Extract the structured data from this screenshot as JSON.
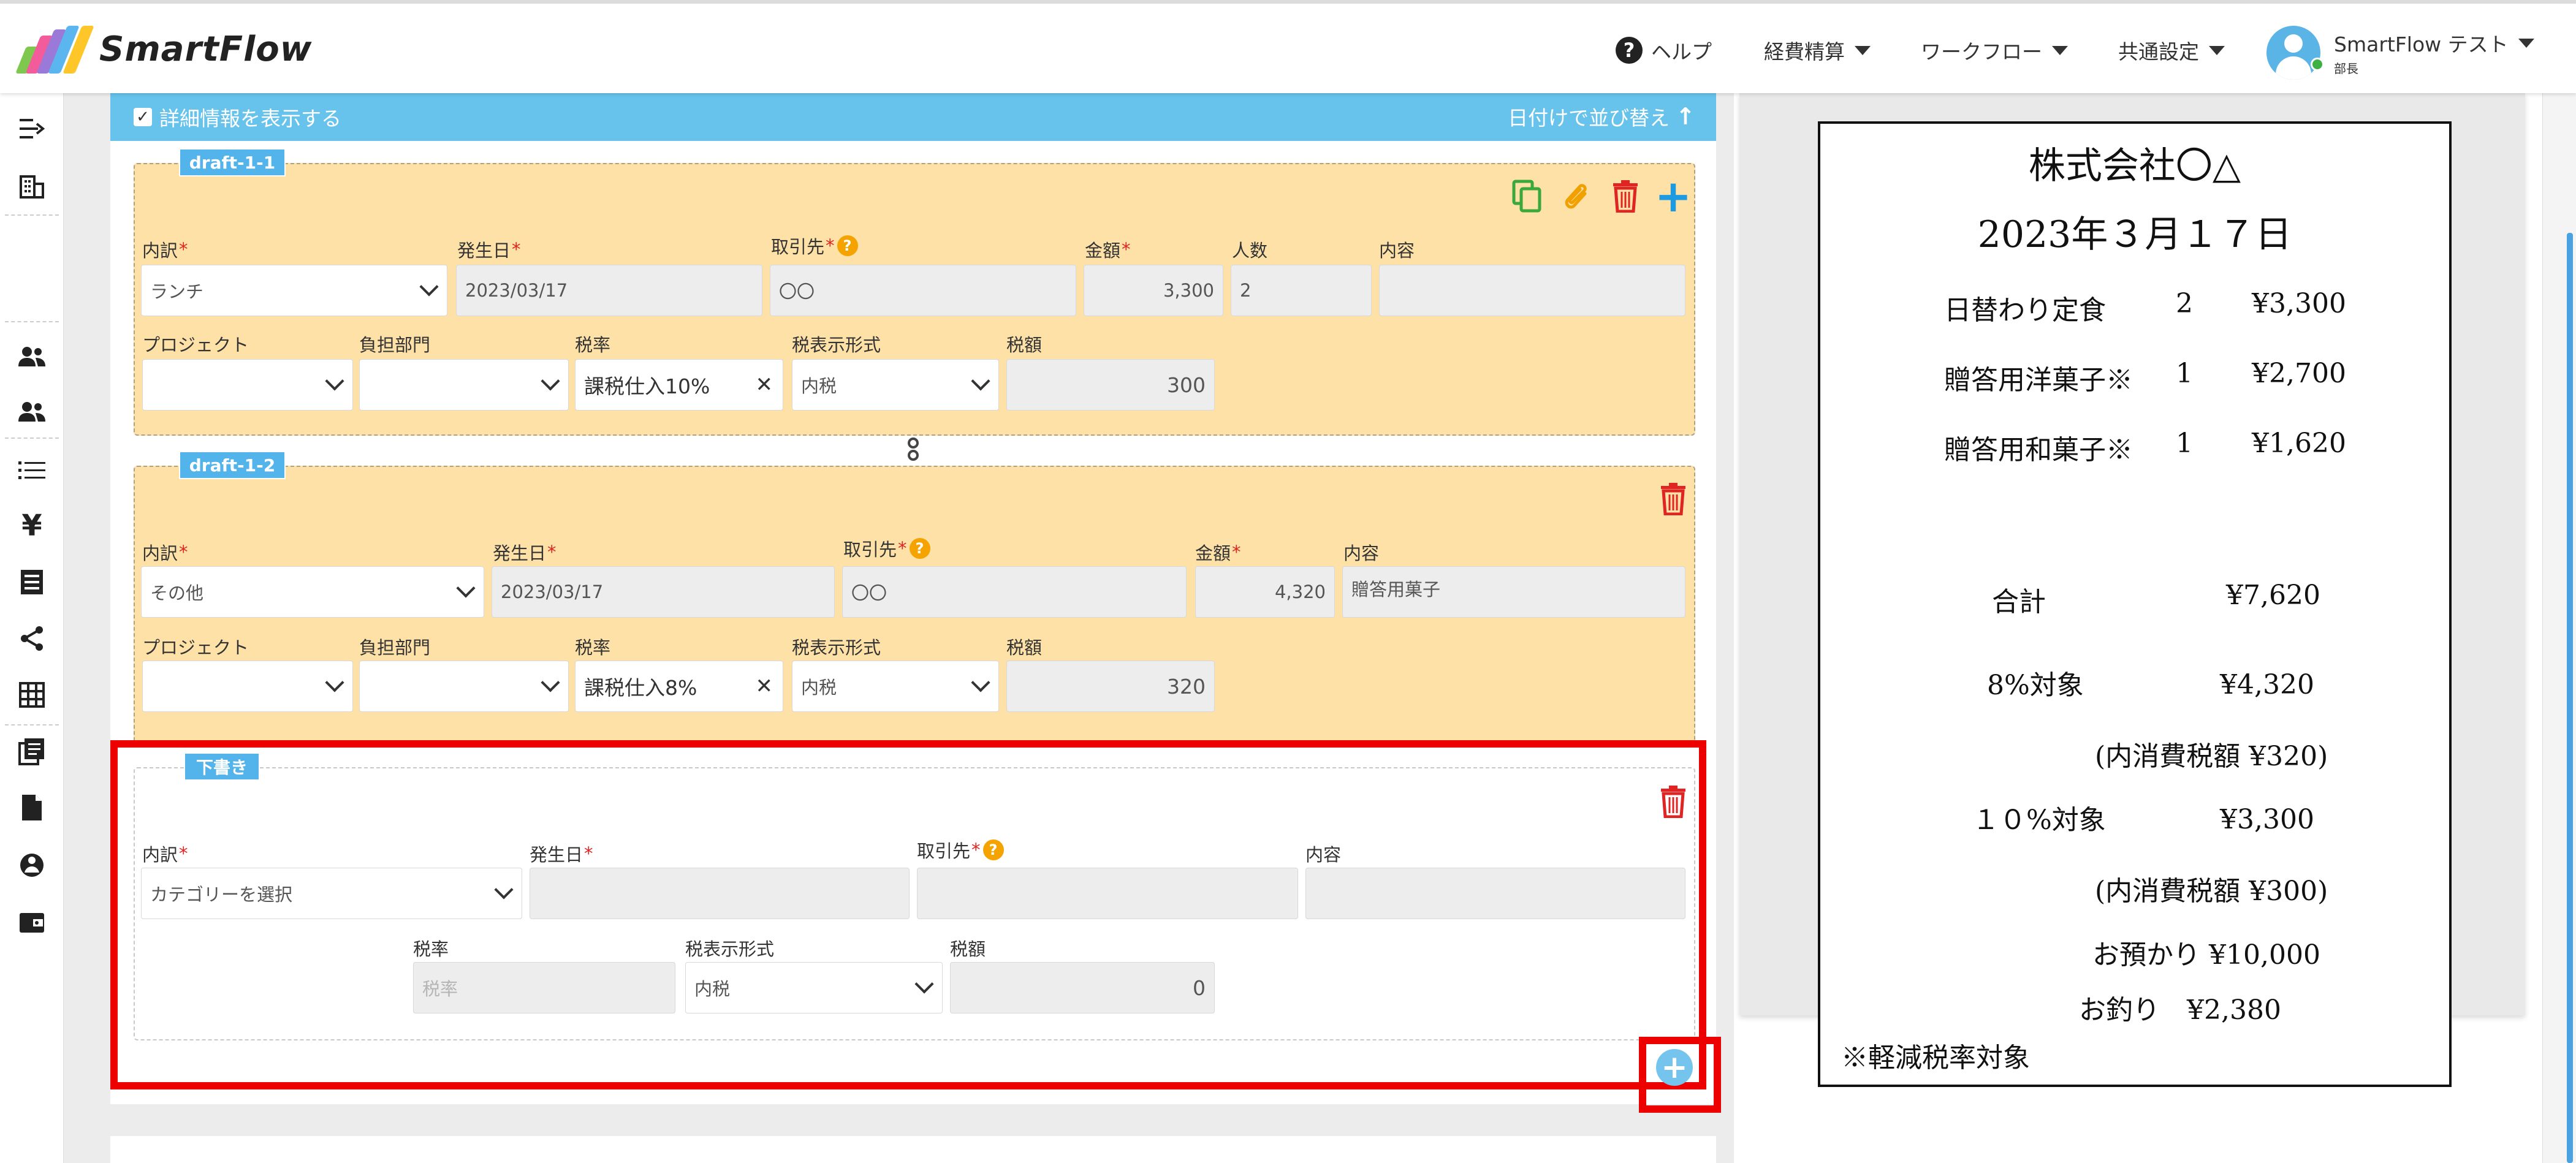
{
  "header": {
    "brand": "SmartFlow",
    "logo_colors": [
      "#7ec850",
      "#f25c9b",
      "#9b79d9",
      "#5bb6ef",
      "#ffc629"
    ],
    "help": "ヘルプ",
    "menus": [
      "経費精算",
      "ワークフロー",
      "共通設定"
    ],
    "user_name": "SmartFlow テスト",
    "user_role": "部長"
  },
  "toolbar": {
    "show_details": "詳細情報を表示する",
    "show_details_checked": true,
    "sort_by_date": "日付けで並び替え"
  },
  "sidebar_icons": [
    "expand-icon",
    "company-icon",
    "users-icon",
    "team-icon",
    "list-icon",
    "yen-icon",
    "receipt-icon",
    "share-icon",
    "grid-icon",
    "documents-icon",
    "file-icon",
    "globe-icon",
    "wallet-icon"
  ],
  "labels": {
    "category": "内訳",
    "date": "発生日",
    "vendor": "取引先",
    "amount": "金額",
    "people": "人数",
    "description": "内容",
    "project": "プロジェクト",
    "department": "負担部門",
    "tax_rate": "税率",
    "tax_display": "税表示形式",
    "tax_amount": "税額",
    "required_mark": "*",
    "help_mark": "?"
  },
  "entries": [
    {
      "tag": "draft-1-1",
      "category": "ランチ",
      "date": "2023/03/17",
      "vendor": "〇〇",
      "amount": "3,300",
      "people": "2",
      "description": "",
      "project": "",
      "department": "",
      "tax_rate": "課税仕入10%",
      "tax_display": "内税",
      "tax_amount": "300"
    },
    {
      "tag": "draft-1-2",
      "category": "その他",
      "date": "2023/03/17",
      "vendor": "〇〇",
      "amount": "4,320",
      "description": "贈答用菓子",
      "project": "",
      "department": "",
      "tax_rate": "課税仕入8%",
      "tax_display": "内税",
      "tax_amount": "320"
    }
  ],
  "draft": {
    "tag": "下書き",
    "category_placeholder": "カテゴリーを選択",
    "date": "",
    "vendor": "",
    "description": "",
    "tax_rate_placeholder": "税率",
    "tax_display": "内税",
    "tax_amount": "0"
  },
  "receipt": {
    "company": "株式会社〇△",
    "date": "2023年３月１７日",
    "items": [
      {
        "name": "日替わり定食",
        "qty": "2",
        "price": "¥3,300"
      },
      {
        "name": "贈答用洋菓子※",
        "qty": "1",
        "price": "¥2,700"
      },
      {
        "name": "贈答用和菓子※",
        "qty": "1",
        "price": "¥1,620"
      }
    ],
    "total_label": "合計",
    "total": "¥7,620",
    "rate8_label": "8%対象",
    "rate8": "¥4,320",
    "rate8_tax": "(内消費税額 ¥320)",
    "rate10_label": "１０%対象",
    "rate10": "¥3,300",
    "rate10_tax": "(内消費税額 ¥300)",
    "received": "お預かり ¥10,000",
    "change": "お釣り　¥2,380",
    "note": "※軽減税率対象"
  },
  "colors": {
    "accent": "#67c3ec",
    "entry_bg": "#fde1a7",
    "highlight": "#ec0000",
    "trash": "#e02424",
    "copy": "#3aa83a",
    "clip": "#f0a000",
    "plus": "#1e9be0"
  }
}
